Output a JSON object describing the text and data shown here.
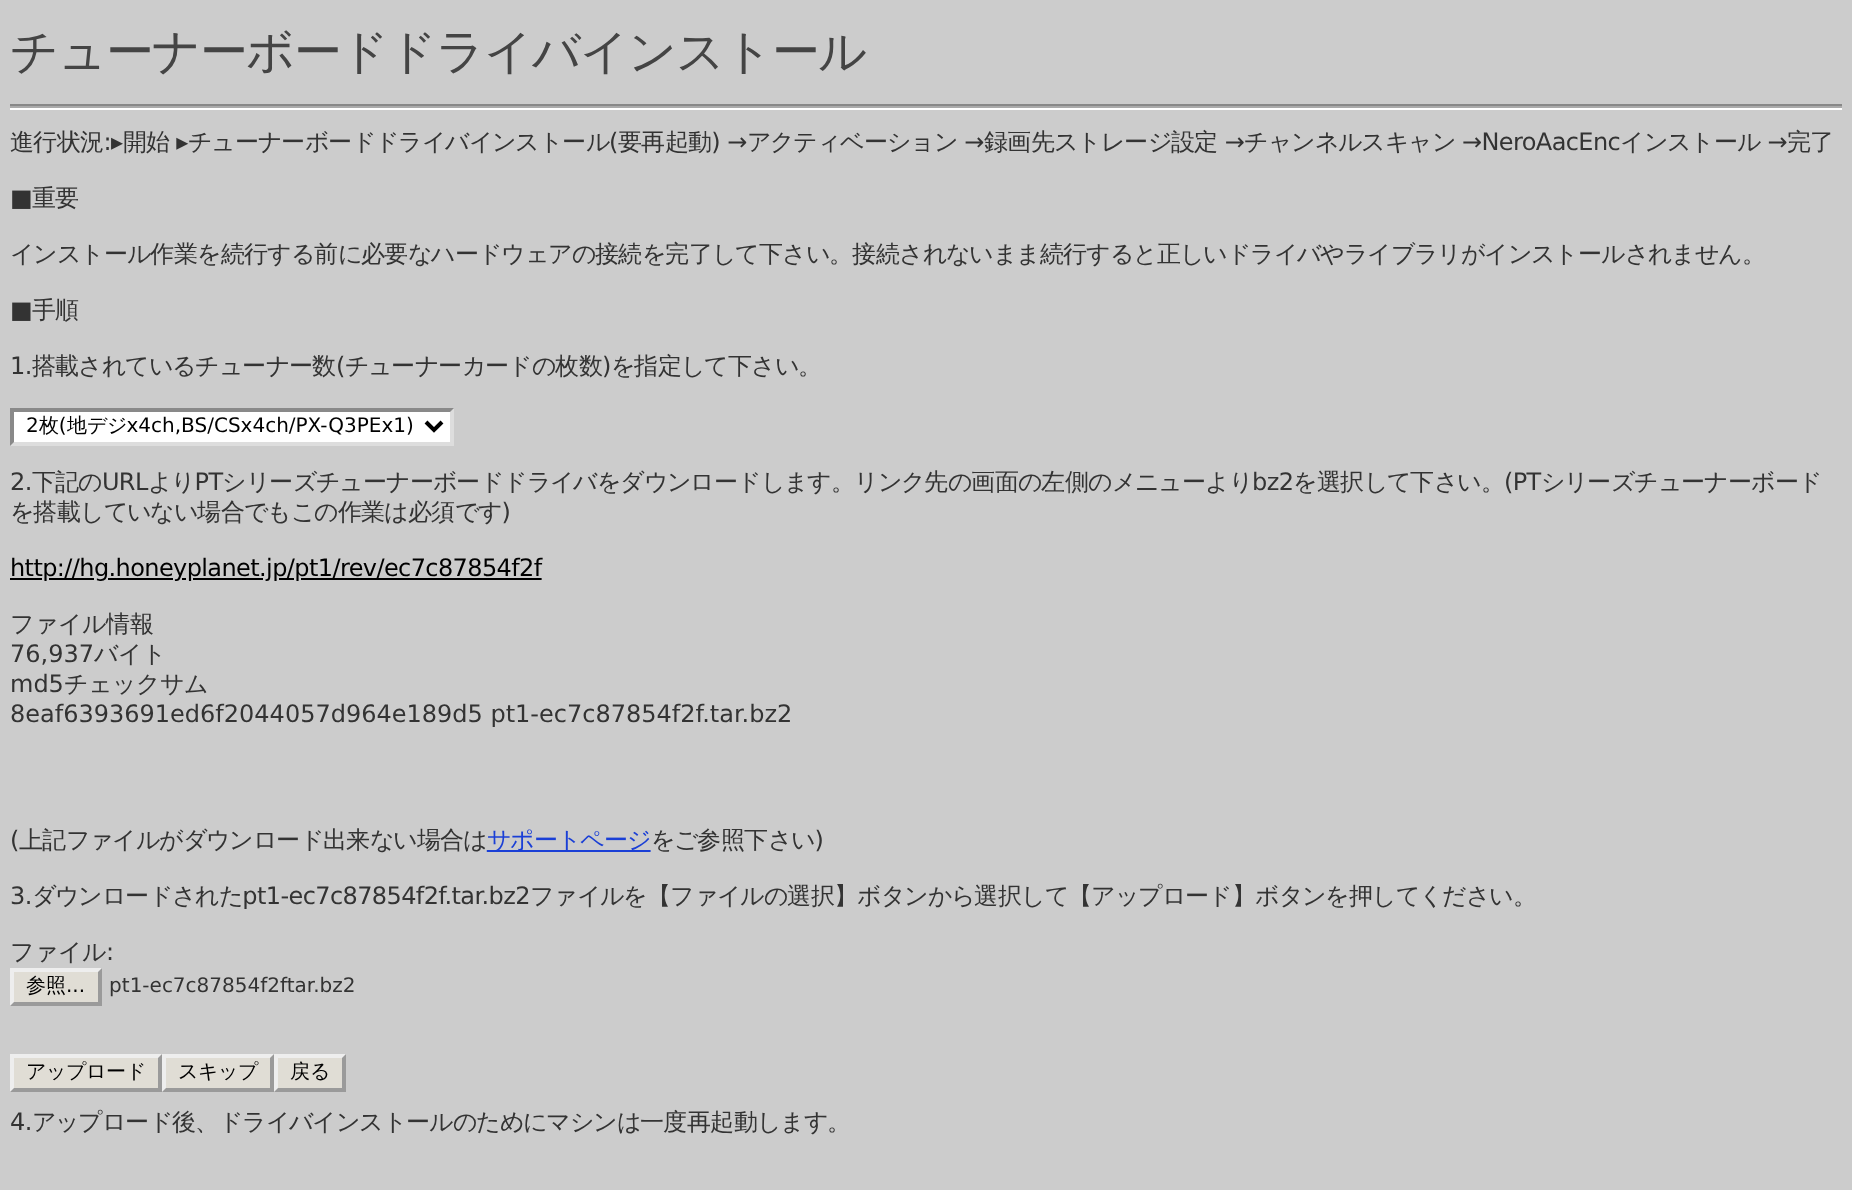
{
  "title": "チューナーボードドライバインストール",
  "progress": "進行状況:▸開始 ▸チューナーボードドライバインストール(要再起動) →アクティベーション →録画先ストレージ設定 →チャンネルスキャン →NeroAacEncインストール →完了",
  "important": {
    "heading": "■重要",
    "text": "インストール作業を続行する前に必要なハードウェアの接続を完了して下さい。接続されないまま続行すると正しいドライバやライブラリがインストールされません。"
  },
  "procedure": {
    "heading": "■手順",
    "step1": "1.搭載されているチューナー数(チューナーカードの枚数)を指定して下さい。",
    "tuner_select": {
      "value": "2枚(地デジx4ch,BS/CSx4ch/PX-Q3PEx1)"
    },
    "step2": "2.下記のURLよりPTシリーズチューナーボードドライバをダウンロードします。リンク先の画面の左側のメニューよりbz2を選択して下さい。(PTシリーズチューナーボードを搭載していない場合でもこの作業は必須です)",
    "url": "http://hg.honeyplanet.jp/pt1/rev/ec7c87854f2f",
    "file_info": [
      "ファイル情報",
      "76,937バイト",
      "md5チェックサム",
      "8eaf6393691ed6f2044057d964e189d5 pt1-ec7c87854f2f.tar.bz2"
    ],
    "note": {
      "before": "(上記ファイルがダウンロード出来ない場合は",
      "link": "サポートページ",
      "after": "をご参照下さい)"
    },
    "step3": "3.ダウンロードされたpt1-ec7c87854f2f.tar.bz2ファイルを【ファイルの選択】ボタンから選択して【アップロード】ボタンを押してください。",
    "file_label": "ファイル:",
    "browse_button": "参照...",
    "file_name": "pt1-ec7c87854f2ftar.bz2",
    "buttons": [
      "アップロード",
      "スキップ",
      "戻る"
    ],
    "step4": "4.アップロード後、ドライバインストールのためにマシンは一度再起動します。"
  }
}
